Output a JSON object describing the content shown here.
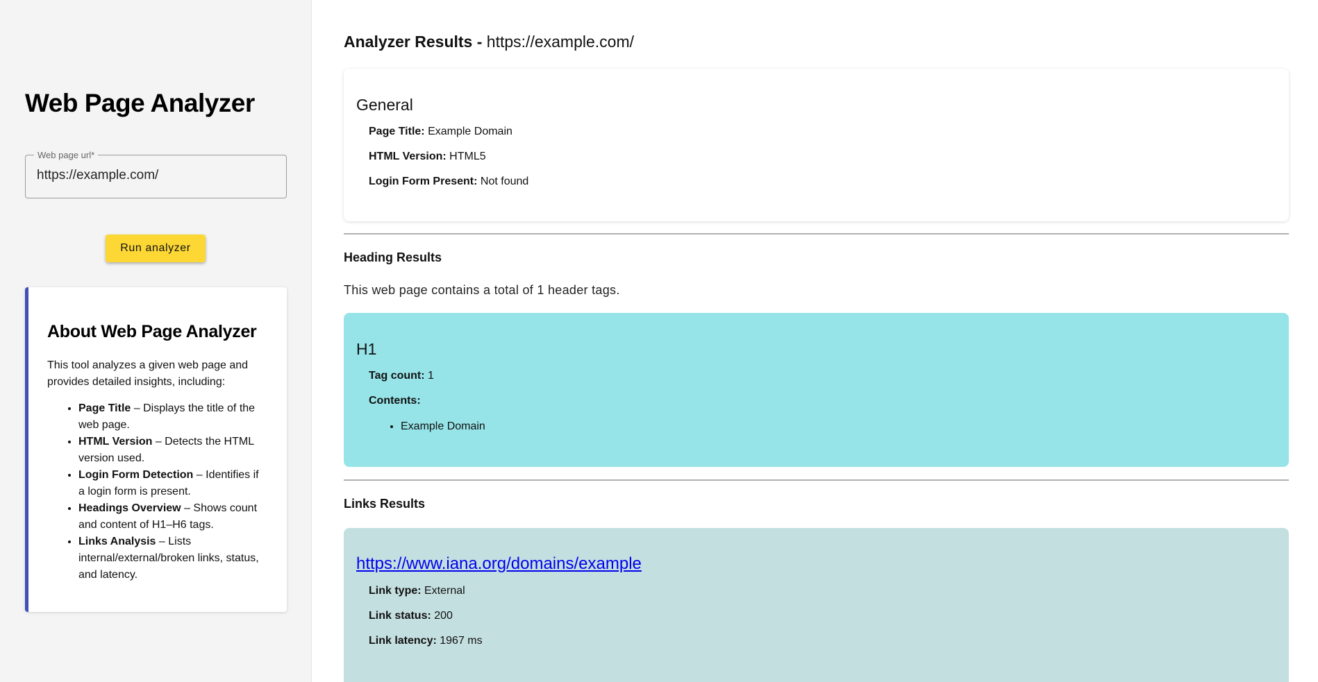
{
  "sidebar": {
    "app_title": "Web Page Analyzer",
    "url_field": {
      "label": "Web page url*",
      "value": "https://example.com/"
    },
    "run_button_label": "Run analyzer",
    "about": {
      "title": "About Web Page Analyzer",
      "description": "This tool analyzes a given web page and provides detailed insights, including:",
      "items": [
        {
          "name": "Page Title",
          "text": " – Displays the title of the web page."
        },
        {
          "name": "HTML Version",
          "text": " – Detects the HTML version used."
        },
        {
          "name": "Login Form Detection",
          "text": " – Identifies if a login form is present."
        },
        {
          "name": "Headings Overview",
          "text": " – Shows count and content of H1–H6 tags."
        },
        {
          "name": "Links Analysis",
          "text": " – Lists internal/external/broken links, status, and latency."
        }
      ],
      "accent_color": "#3f51b5"
    }
  },
  "results": {
    "title_label": "Analyzer Results - ",
    "title_url": "https://example.com/",
    "general": {
      "title": "General",
      "page_title_label": "Page Title:",
      "page_title_value": " Example Domain",
      "html_version_label": "HTML Version:",
      "html_version_value": " HTML5",
      "login_form_label": "Login Form Present:",
      "login_form_value": " Not found"
    },
    "headings": {
      "section_title": "Heading Results",
      "summary": "This web page contains a total of 1 header tags.",
      "cards": [
        {
          "tag": "H1",
          "tag_count_label": "Tag count:",
          "tag_count_value": " 1",
          "contents_label": "Contents:",
          "contents": [
            "Example Domain"
          ]
        }
      ],
      "card_color": "#96e4e8"
    },
    "links": {
      "section_title": "Links Results",
      "cards": [
        {
          "url": "https://www.iana.org/domains/example",
          "type_label": "Link type:",
          "type_value": " External",
          "status_label": "Link status:",
          "status_value": " 200",
          "latency_label": "Link latency:",
          "latency_value": " 1967 ms"
        }
      ],
      "card_color": "#c4dfe0"
    }
  },
  "colors": {
    "button": "#fdd835",
    "sidebar_bg": "#f4f4f4",
    "link": "#0000ee"
  }
}
